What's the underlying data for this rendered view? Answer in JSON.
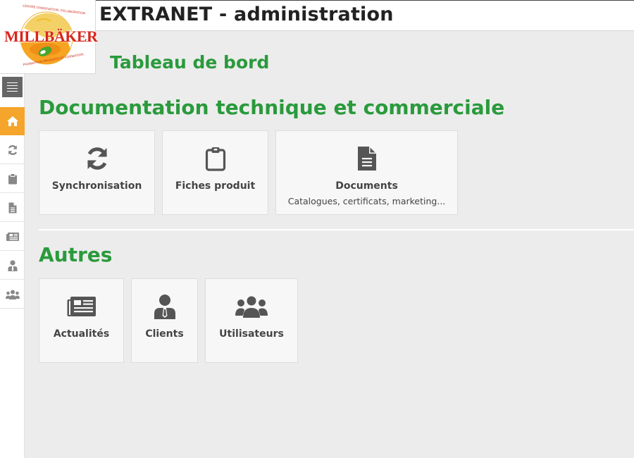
{
  "header": {
    "app_title": "EXTRANET - administration"
  },
  "logo": {
    "brand": "MILLBÄKER",
    "top_text": "CENTRE D'INNOVATION, D'ELABORATION",
    "bottom_text": "PROMOTION PRODUITS ET FORMATION"
  },
  "sidebar": {
    "items": [
      {
        "icon": "menu-icon",
        "active": false
      },
      {
        "icon": "home-icon",
        "active": true
      },
      {
        "icon": "refresh-icon",
        "active": false
      },
      {
        "icon": "clipboard-icon",
        "active": false
      },
      {
        "icon": "document-icon",
        "active": false
      },
      {
        "icon": "newspaper-icon",
        "active": false
      },
      {
        "icon": "user-tie-icon",
        "active": false
      },
      {
        "icon": "users-icon",
        "active": false
      }
    ]
  },
  "main": {
    "page_title": "Tableau de bord",
    "sections": [
      {
        "title": "Documentation technique et commerciale",
        "tiles": [
          {
            "label": "Synchronisation",
            "icon": "refresh-icon"
          },
          {
            "label": "Fiches produit",
            "icon": "clipboard-icon"
          },
          {
            "label": "Documents",
            "sublabel": "Catalogues, certificats, marketing...",
            "icon": "document-icon"
          }
        ]
      },
      {
        "title": "Autres",
        "tiles": [
          {
            "label": "Actualités",
            "icon": "newspaper-icon"
          },
          {
            "label": "Clients",
            "icon": "user-tie-icon"
          },
          {
            "label": "Utilisateurs",
            "icon": "users-icon"
          }
        ]
      }
    ]
  },
  "colors": {
    "accent_green": "#2a9a3c",
    "active_orange": "#f5a52b",
    "icon_gray": "#555555",
    "sidebar_icon_gray": "#888888",
    "logo_red": "#d9251d"
  }
}
